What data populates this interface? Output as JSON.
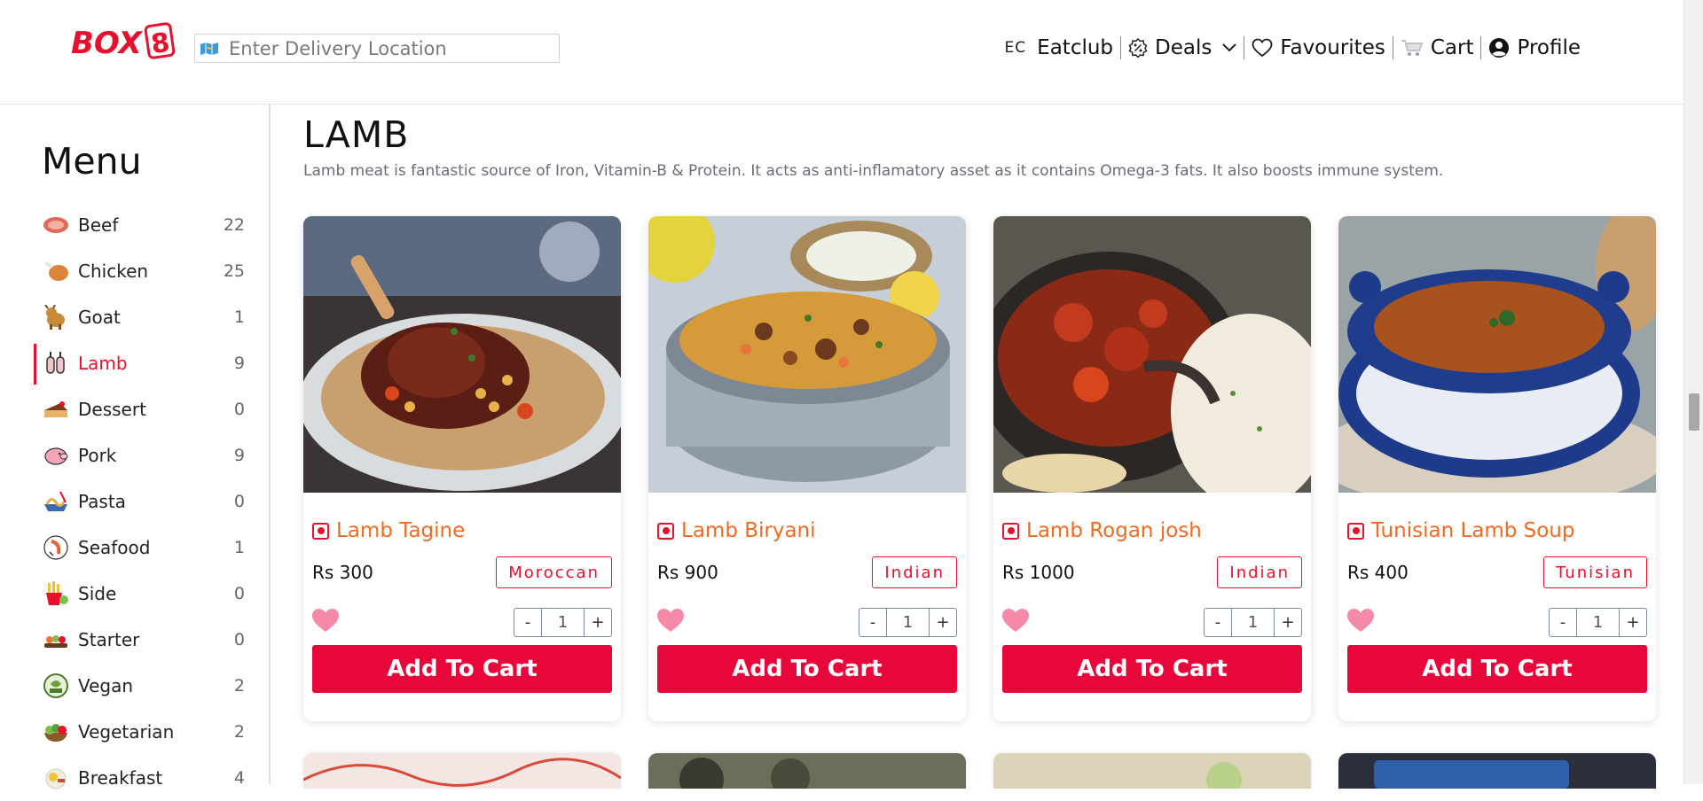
{
  "header": {
    "logo": "BOX8",
    "location_placeholder": "Enter Delivery Location",
    "nav": {
      "eatclub_icon": "EC",
      "eatclub": "Eatclub",
      "deals": "Deals",
      "favourites": "Favourites",
      "cart": "Cart",
      "profile": "Profile"
    }
  },
  "sidebar": {
    "title": "Menu",
    "categories": [
      {
        "name": "Beef",
        "count": "22",
        "icon": "steak-icon"
      },
      {
        "name": "Chicken",
        "count": "25",
        "icon": "chicken-leg-icon"
      },
      {
        "name": "Goat",
        "count": "1",
        "icon": "goat-icon"
      },
      {
        "name": "Lamb",
        "count": "9",
        "icon": "lamb-icon",
        "active": true
      },
      {
        "name": "Dessert",
        "count": "0",
        "icon": "cake-icon"
      },
      {
        "name": "Pork",
        "count": "9",
        "icon": "pig-icon"
      },
      {
        "name": "Pasta",
        "count": "0",
        "icon": "pasta-icon"
      },
      {
        "name": "Seafood",
        "count": "1",
        "icon": "seafood-icon"
      },
      {
        "name": "Side",
        "count": "0",
        "icon": "fries-icon"
      },
      {
        "name": "Starter",
        "count": "0",
        "icon": "starter-icon"
      },
      {
        "name": "Vegan",
        "count": "2",
        "icon": "vegan-badge-icon"
      },
      {
        "name": "Vegetarian",
        "count": "2",
        "icon": "salad-icon"
      },
      {
        "name": "Breakfast",
        "count": "4",
        "icon": "breakfast-icon"
      }
    ]
  },
  "section": {
    "title": "LAMB",
    "description": "Lamb meat is fantastic source of Iron, Vitamin-B & Protein. It acts as anti-inflamatory asset as it contains Omega-3 fats. It also boosts immune system."
  },
  "dishes": [
    {
      "name": "Lamb Tagine",
      "price": "Rs 300",
      "cuisine": "Moroccan",
      "qty": "1",
      "add_label": "Add To Cart",
      "minus": "-",
      "plus": "+"
    },
    {
      "name": "Lamb Biryani",
      "price": "Rs 900",
      "cuisine": "Indian",
      "qty": "1",
      "add_label": "Add To Cart",
      "minus": "-",
      "plus": "+"
    },
    {
      "name": "Lamb Rogan josh",
      "price": "Rs 1000",
      "cuisine": "Indian",
      "qty": "1",
      "add_label": "Add To Cart",
      "minus": "-",
      "plus": "+"
    },
    {
      "name": "Tunisian Lamb Soup",
      "price": "Rs 400",
      "cuisine": "Tunisian",
      "qty": "1",
      "add_label": "Add To Cart",
      "minus": "-",
      "plus": "+"
    }
  ],
  "colors": {
    "brand_red": "#e8102c",
    "button_red": "#e8073a",
    "dish_orange": "#f26a22",
    "heart_pink": "#f48aa8"
  }
}
